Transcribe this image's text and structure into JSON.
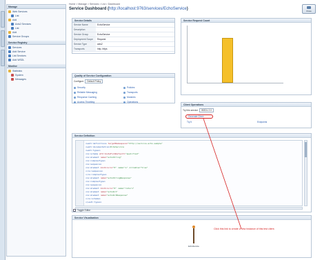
{
  "sidebar": {
    "section1_title": "Manage",
    "section2_title": "Service Registry",
    "section3_title": "Monitor",
    "items1": [
      "Web Services",
      "List",
      "Add",
      "Axis2 Services",
      "List",
      "Add",
      "Service Groups"
    ],
    "items2": [
      "Services",
      "Add Service",
      "List Services",
      "Add WSDL"
    ],
    "items3": [
      "Statistics",
      "System",
      "Messages"
    ]
  },
  "header": {
    "crumb": "Home > Manage > Services > List > Dashboard",
    "title_prefix": "Service Dashboard (",
    "title_link": "http://localhost:9763/services/EchoService",
    "title_suffix": ")"
  },
  "close_button": {
    "label": "Close"
  },
  "service_details": {
    "title": "Service Details",
    "rows": [
      {
        "k": "Service Name",
        "v": "EchoService"
      },
      {
        "k": "Description",
        "v": ""
      },
      {
        "k": "Service Group",
        "v": "EchoService"
      },
      {
        "k": "Deployment Scope",
        "v": "Request"
      },
      {
        "k": "Service Type",
        "v": "axis2"
      },
      {
        "k": "Transports",
        "v": "http, https"
      }
    ]
  },
  "stats": {
    "title": "Service Request Count"
  },
  "quality": {
    "title": "Quality of Service Configuration",
    "select_label": "Configure",
    "select_value": "Default Policy",
    "left_items": [
      "Security",
      "Reliable Messaging",
      "Response Caching",
      "Access Throttling"
    ],
    "right_items": [
      "Policies",
      "Transports",
      "Modules",
      "Operations"
    ]
  },
  "client": {
    "title": "Client Operations",
    "select_label": "Try this service",
    "select_value": "WSDL 2.0",
    "link1": "Generate Client",
    "link2": "Try It",
    "link3": "Endpoints"
  },
  "wsdl": {
    "title": "Service Definition",
    "lines": [
      {
        "t": "<wsdl:definitions ",
        "a": "targetNamespace=",
        "v": "\"http://service.echo.sample\""
      },
      {
        "t": "  <wsdl:documentation>",
        "a": "",
        "v": "EchoService"
      },
      {
        "t": "  <wsdl:types>",
        "a": "",
        "v": ""
      },
      {
        "t": "    <xs:schema ",
        "a": "attributeFormDefault=",
        "v": "\"qualified\""
      },
      {
        "t": "      <xs:element ",
        "a": "name=",
        "v": "\"echoString\""
      },
      {
        "t": "        <xs:complexType>",
        "a": "",
        "v": ""
      },
      {
        "t": "          <xs:sequence>",
        "a": "",
        "v": ""
      },
      {
        "t": "            <xs:element ",
        "a": "minOccurs=",
        "v": "\"0\" name=\"s\" nillable=\"true\""
      },
      {
        "t": "          </xs:sequence>",
        "a": "",
        "v": ""
      },
      {
        "t": "        </xs:complexType>",
        "a": "",
        "v": ""
      },
      {
        "t": "      <xs:element ",
        "a": "name=",
        "v": "\"echoStringResponse\""
      },
      {
        "t": "        <xs:complexType>",
        "a": "",
        "v": ""
      },
      {
        "t": "          <xs:sequence>",
        "a": "",
        "v": ""
      },
      {
        "t": "            <xs:element ",
        "a": "minOccurs=",
        "v": "\"0\" name=\"return\""
      },
      {
        "t": "            <xs:element ",
        "a": "name=",
        "v": "\"echoInt\""
      },
      {
        "t": "            <xs:element ",
        "a": "name=",
        "v": "\"echoIntResponse\""
      },
      {
        "t": "    </xs:schema>",
        "a": "",
        "v": ""
      },
      {
        "t": "  </wsdl:types>",
        "a": "",
        "v": ""
      }
    ],
    "toggle_label": "Toggle Editor"
  },
  "visual": {
    "title": "Service Visualization",
    "node_label": "EchoService"
  },
  "annotation": {
    "text": "Click this link to create a new instance of this test client."
  },
  "chart_data": {
    "type": "bar",
    "title": "",
    "categories": [
      "",
      "",
      "",
      "",
      "",
      ""
    ],
    "values": [
      0,
      0,
      1,
      0,
      0,
      0
    ],
    "ylim": [
      0,
      1.3
    ],
    "bar_color": "#f5c02a",
    "grid": false
  }
}
